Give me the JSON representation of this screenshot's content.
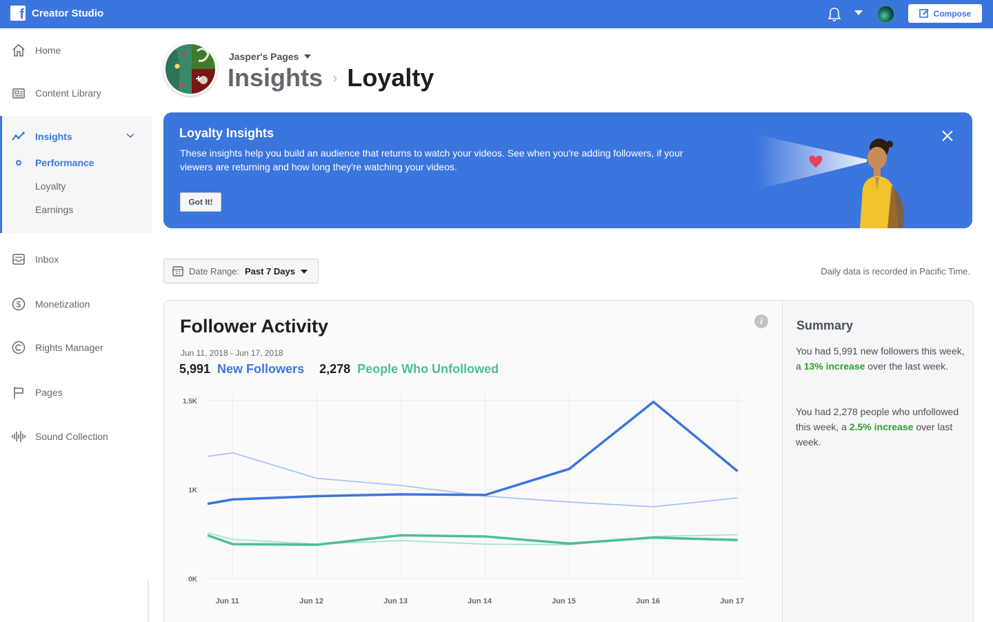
{
  "app": {
    "title": "Creator Studio",
    "compose_label": "Compose"
  },
  "sidebar": {
    "items": [
      {
        "label": "Home"
      },
      {
        "label": "Content Library"
      },
      {
        "label": "Insights"
      },
      {
        "label": "Inbox"
      },
      {
        "label": "Monetization"
      },
      {
        "label": "Rights Manager"
      },
      {
        "label": "Pages"
      },
      {
        "label": "Sound Collection"
      }
    ],
    "insights_sub": [
      {
        "label": "Performance"
      },
      {
        "label": "Loyalty"
      },
      {
        "label": "Earnings"
      }
    ]
  },
  "header": {
    "page_name": "Jasper's Pages",
    "breadcrumb_parent": "Insights",
    "breadcrumb_current": "Loyalty"
  },
  "banner": {
    "title": "Loyalty Insights",
    "text": "These insights help you build an audience that returns to watch your videos. See when you're adding followers, if your viewers are returning and how long they're watching your videos.",
    "button": "Got It!"
  },
  "date_range": {
    "label": "Date Range:",
    "value": "Past 7 Days"
  },
  "timezone_note": "Daily data is recorded in Pacific Time.",
  "card": {
    "title": "Follower Activity",
    "date_span": "Jun 11, 2018 - Jun 17, 2018",
    "new_followers_count": "5,991",
    "new_followers_label": "New Followers",
    "unfollowed_count": "2,278",
    "unfollowed_label": "People Who Unfollowed"
  },
  "summary": {
    "title": "Summary",
    "p1_a": "You had 5,991 new followers this week, a ",
    "p1_hl": "13% increase",
    "p1_b": " over the last week.",
    "p2_a": "You had 2,278 people who unfollowed this week, a ",
    "p2_hl": "2.5% increase",
    "p2_b": " over last week."
  },
  "colors": {
    "brand": "#3b75de",
    "new_followers": "#3b75de",
    "unfollowed": "#4dbd9c",
    "increase": "#2da12d"
  },
  "chart_data": {
    "type": "line",
    "categories": [
      "Jun 11",
      "Jun 12",
      "Jun 13",
      "Jun 14",
      "Jun 15",
      "Jun 16",
      "Jun 17"
    ],
    "y_ticks": [
      "1.5K",
      "1K",
      "0K"
    ],
    "ylim": [
      0,
      1500
    ],
    "series": [
      {
        "name": "New Followers",
        "style": "bold",
        "color": "#3b75de",
        "x": [
          0,
          0.3,
          1.3,
          2.3,
          3.3,
          4.3,
          5.3,
          6.3
        ],
        "values": [
          630,
          667,
          695,
          710,
          705,
          925,
          1490,
          905
        ]
      },
      {
        "name": "New Followers (previous period)",
        "style": "light",
        "color": "#a9c5f7",
        "x": [
          0,
          0.3,
          1.3,
          2.3,
          3.3,
          4.3,
          5.3,
          6.3
        ],
        "values": [
          1030,
          1060,
          845,
          785,
          695,
          645,
          605,
          680
        ]
      },
      {
        "name": "People Who Unfollowed",
        "style": "bold",
        "color": "#4dbd9c",
        "x": [
          0,
          0.3,
          1.3,
          2.3,
          3.3,
          4.3,
          5.3,
          6.3
        ],
        "values": [
          365,
          290,
          285,
          365,
          355,
          295,
          345,
          325
        ]
      },
      {
        "name": "People Who Unfollowed (previous period)",
        "style": "light",
        "color": "#a6e1cf",
        "x": [
          0,
          0.3,
          1.3,
          2.3,
          3.3,
          4.3,
          5.3,
          6.3
        ],
        "values": [
          385,
          330,
          290,
          320,
          290,
          285,
          355,
          370
        ]
      }
    ]
  }
}
